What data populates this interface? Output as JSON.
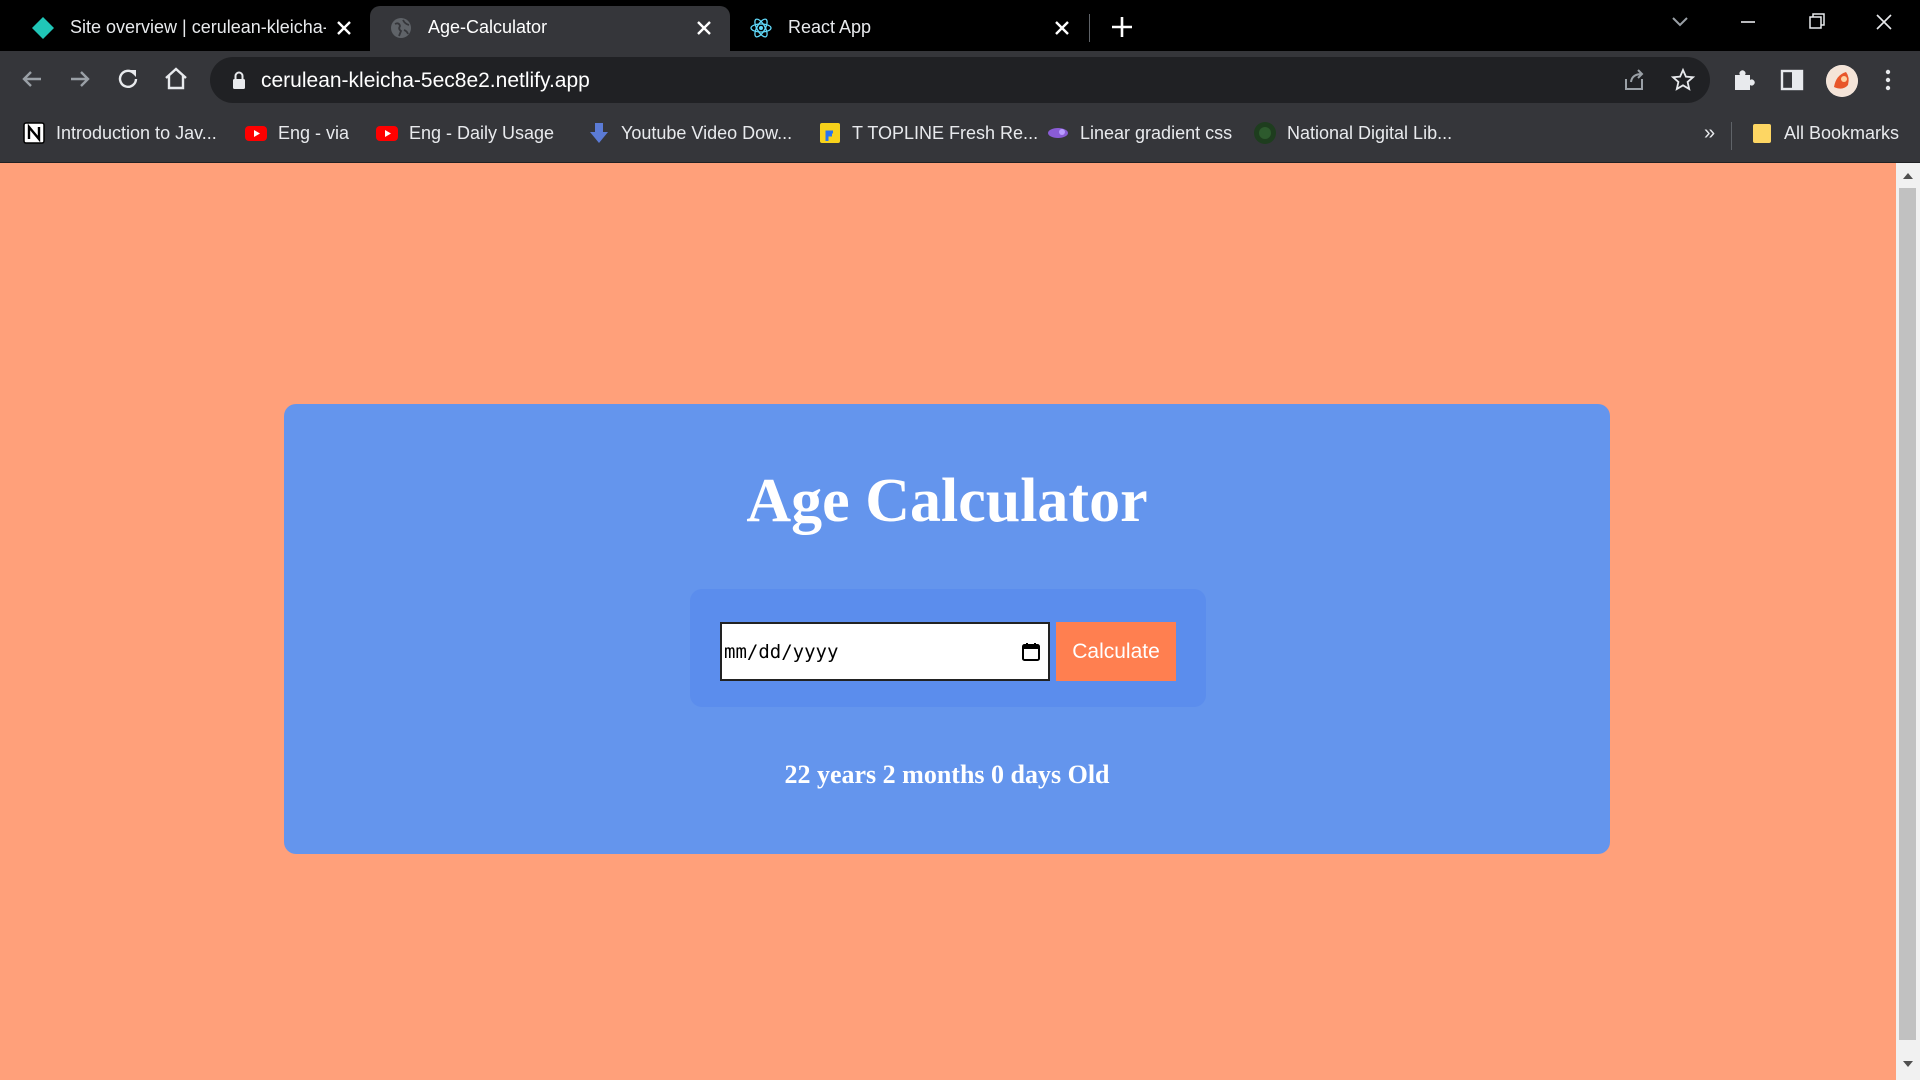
{
  "browser": {
    "tabs": [
      {
        "title": "Site overview | cerulean-kleicha-",
        "favicon": "netlify-diamond-icon",
        "active": false
      },
      {
        "title": "Age-Calculator",
        "favicon": "globe-icon",
        "active": true
      },
      {
        "title": "React App",
        "favicon": "react-icon",
        "active": false
      }
    ],
    "url": "cerulean-kleicha-5ec8e2.netlify.app",
    "bookmarks": [
      {
        "label": "Introduction to Jav...",
        "icon": "notion-icon"
      },
      {
        "label": "Eng - via",
        "icon": "youtube-icon"
      },
      {
        "label": "Eng -  Daily Usage",
        "icon": "youtube-icon"
      },
      {
        "label": "Youtube Video Dow...",
        "icon": "download-arrow-icon"
      },
      {
        "label": "T TOPLINE Fresh Re...",
        "icon": "flipkart-icon"
      },
      {
        "label": "Linear gradient css",
        "icon": "gradient-icon"
      },
      {
        "label": "National Digital Lib...",
        "icon": "ndl-icon"
      }
    ],
    "overflow_label": "»",
    "all_bookmarks_label": "All Bookmarks"
  },
  "page": {
    "title": "Age Calculator",
    "date_input": {
      "placeholder": "mm/dd/yyyy",
      "value": ""
    },
    "button_label": "Calculate",
    "result": "22 years 2 months 0 days Old"
  },
  "colors": {
    "page_background": "#ffa07a",
    "card_background": "#6495ed",
    "button_background": "#ff7f50",
    "text": "#ffffff"
  }
}
